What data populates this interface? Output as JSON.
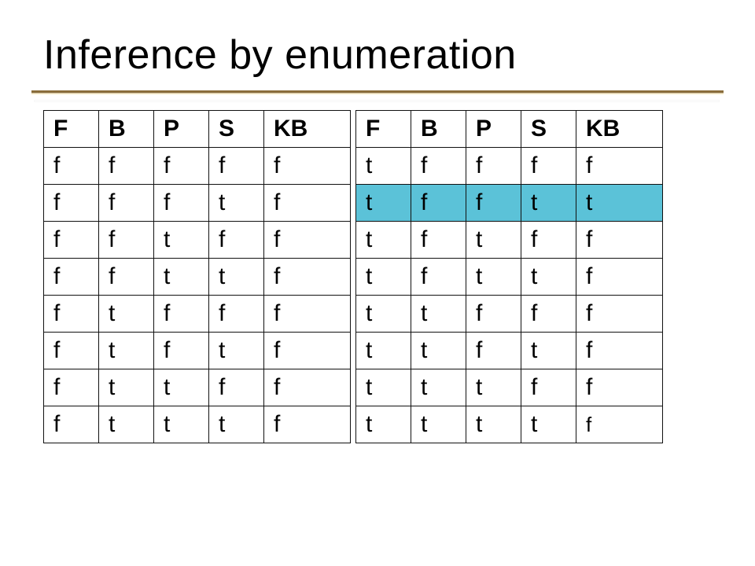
{
  "title": "Inference by enumeration",
  "headers": [
    "F",
    "B",
    "P",
    "S",
    "KB"
  ],
  "left_table": [
    [
      "f",
      "f",
      "f",
      "f",
      "f"
    ],
    [
      "f",
      "f",
      "f",
      "t",
      "f"
    ],
    [
      "f",
      "f",
      "t",
      "f",
      "f"
    ],
    [
      "f",
      "f",
      "t",
      "t",
      "f"
    ],
    [
      "f",
      "t",
      "f",
      "f",
      "f"
    ],
    [
      "f",
      "t",
      "f",
      "t",
      "f"
    ],
    [
      "f",
      "t",
      "t",
      "f",
      "f"
    ],
    [
      "f",
      "t",
      "t",
      "t",
      "f"
    ]
  ],
  "right_table": [
    [
      "t",
      "f",
      "f",
      "f",
      "f"
    ],
    [
      "t",
      "f",
      "f",
      "t",
      "t"
    ],
    [
      "t",
      "f",
      "t",
      "f",
      "f"
    ],
    [
      "t",
      "f",
      "t",
      "t",
      "f"
    ],
    [
      "t",
      "t",
      "f",
      "f",
      "f"
    ],
    [
      "t",
      "t",
      "f",
      "t",
      "f"
    ],
    [
      "t",
      "t",
      "t",
      "f",
      "f"
    ],
    [
      "t",
      "t",
      "t",
      "t",
      "f"
    ]
  ],
  "right_highlight_row": 1
}
